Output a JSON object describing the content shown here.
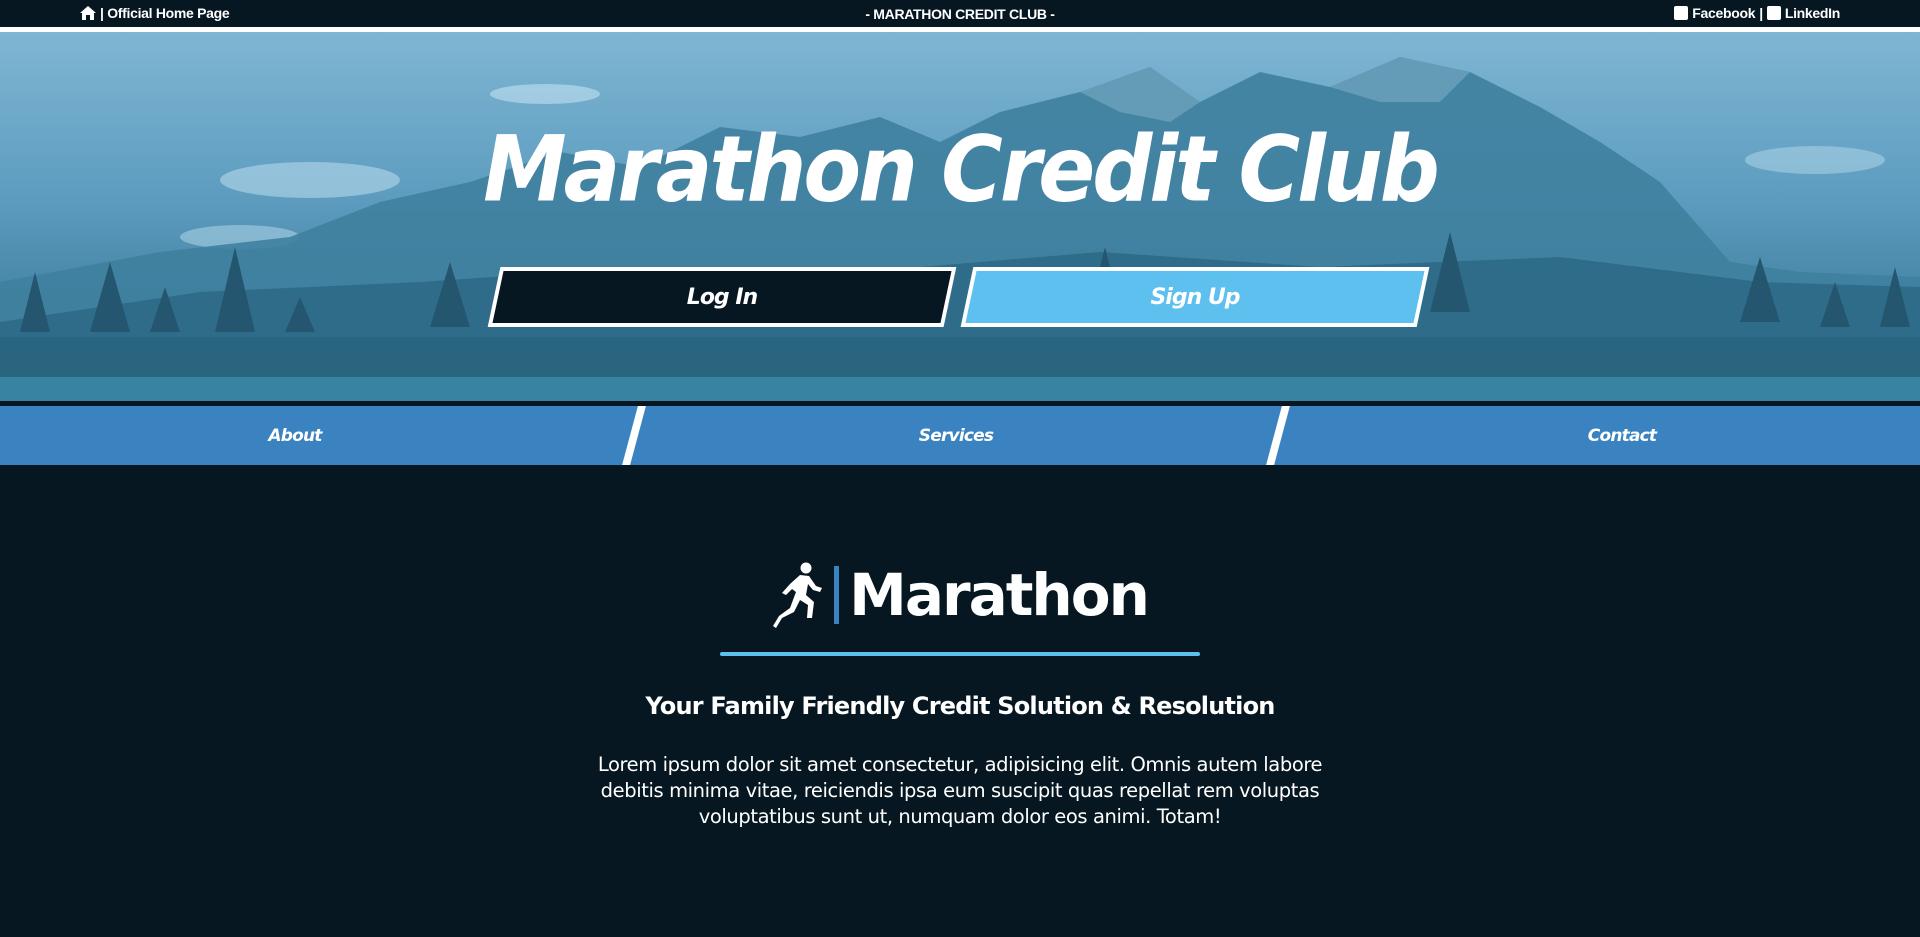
{
  "topbar": {
    "home_label": "| Official Home Page",
    "center_label": "- MARATHON CREDIT CLUB -",
    "facebook_label": "Facebook",
    "separator": "|",
    "linkedin_label": "LinkedIn",
    "icons": [
      "home-icon",
      "facebook-icon",
      "linkedin-icon"
    ]
  },
  "hero": {
    "title": "Marathon Credit Club",
    "login_label": "Log In",
    "signup_label": "Sign Up"
  },
  "nav": {
    "items": [
      {
        "label": "About"
      },
      {
        "label": "Services"
      },
      {
        "label": "Contact"
      }
    ]
  },
  "content": {
    "brand_word": "Marathon",
    "brand_icon": "runner-icon",
    "tagline": "Your Family Friendly Credit Solution & Resolution",
    "body": "Lorem ipsum dolor sit amet consectetur, adipisicing elit. Omnis autem labore debitis minima vitae, reiciendis ipsa eum suscipit quas repellat rem voluptas voluptatibus sunt ut, numquam dolor eos animi. Totam!"
  },
  "colors": {
    "background": "#061721",
    "accent_light": "#5ec0ee",
    "accent_nav": "#3a83c0",
    "white": "#ffffff"
  }
}
